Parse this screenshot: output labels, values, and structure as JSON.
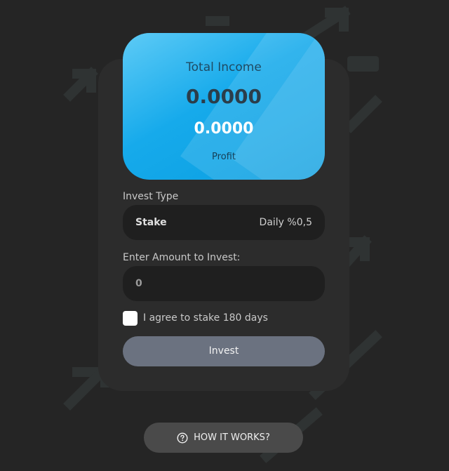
{
  "income_card": {
    "title": "Total Income",
    "total_value": "0.0000",
    "profit_value": "0.0000",
    "profit_label": "Profit"
  },
  "invest_type": {
    "label": "Invest Type",
    "selected_name": "Stake",
    "selected_rate": "Daily %0,5"
  },
  "amount": {
    "label": "Enter Amount to Invest:",
    "value": "0"
  },
  "agreement": {
    "label": "I agree to stake 180 days",
    "checked": false
  },
  "actions": {
    "invest_label": "Invest",
    "how_it_works_label": "HOW IT WORKS?"
  },
  "icons": {
    "how_it_works": "question-circle-icon",
    "background": "arrow-up-right-icon"
  },
  "colors": {
    "card_gradient_start": "#5ecbf6",
    "card_gradient_end": "#0a9ee0",
    "invest_button": "#6b7280",
    "background": "#252525"
  }
}
